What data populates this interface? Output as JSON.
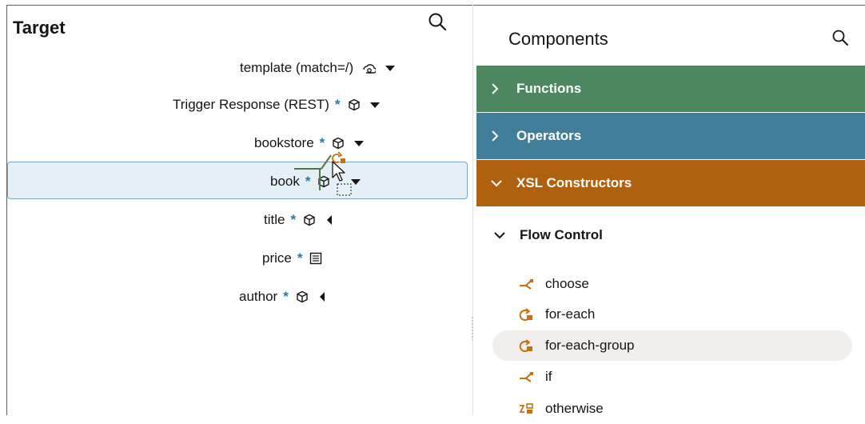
{
  "target": {
    "title": "Target",
    "nodes": [
      {
        "label": "template (match=/)",
        "required": false,
        "icon": "template-icon",
        "toggle": "expanded"
      },
      {
        "label": "Trigger Response (REST)",
        "required": true,
        "icon": "element-icon",
        "toggle": "expanded"
      },
      {
        "label": "bookstore",
        "required": true,
        "icon": "element-icon",
        "toggle": "expanded"
      },
      {
        "label": "book",
        "required": true,
        "icon": "element-icon",
        "toggle": "expanded"
      },
      {
        "label": "title",
        "required": true,
        "icon": "element-icon",
        "toggle": "collapsed"
      },
      {
        "label": "price",
        "required": true,
        "icon": "number-field-icon",
        "toggle": "none"
      },
      {
        "label": "author",
        "required": true,
        "icon": "element-icon",
        "toggle": "collapsed"
      }
    ],
    "required_marker": "*"
  },
  "components": {
    "title": "Components",
    "categories": [
      {
        "label": "Functions",
        "color": "#4d8760",
        "state": "collapsed"
      },
      {
        "label": "Operators",
        "color": "#417e9a",
        "state": "collapsed"
      },
      {
        "label": "XSL Constructors",
        "color": "#b0610f",
        "state": "expanded"
      }
    ],
    "subgroup": {
      "label": "Flow Control",
      "state": "expanded"
    },
    "items": [
      {
        "label": "choose",
        "icon": "branch-icon"
      },
      {
        "label": "for-each",
        "icon": "loop-icon"
      },
      {
        "label": "for-each-group",
        "icon": "loop-icon"
      },
      {
        "label": "if",
        "icon": "branch-icon"
      },
      {
        "label": "otherwise",
        "icon": "otherwise-icon"
      }
    ]
  },
  "colors": {
    "accent_required": "#227aa8",
    "constructor_icon": "#c76f11",
    "drop_line": "#4e7a47"
  }
}
